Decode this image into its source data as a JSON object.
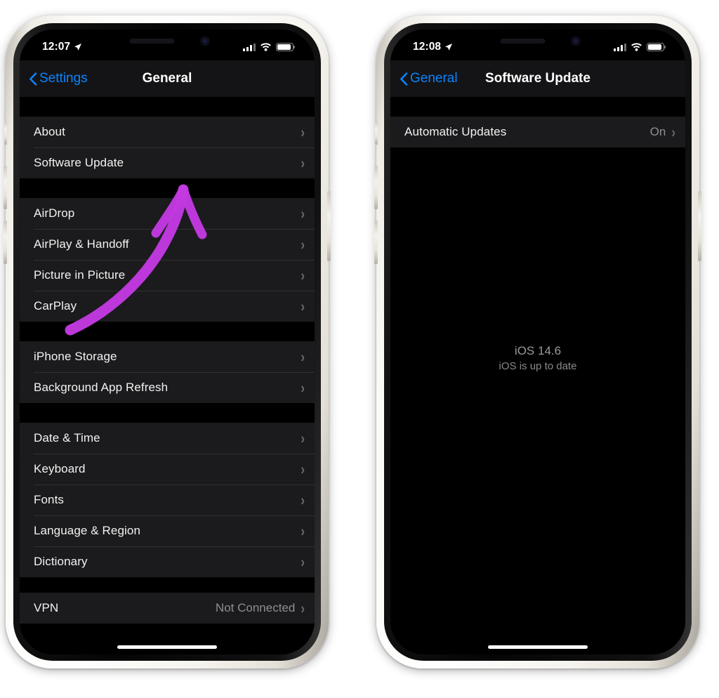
{
  "page": {
    "background_color": "#ffffff",
    "annotation_arrow_color": "#c23ae0"
  },
  "phones": [
    {
      "id": "left",
      "status_bar": {
        "time": "12:07",
        "location_icon": "location-arrow-icon",
        "signal_icon": "cellular-signal-icon",
        "wifi_icon": "wifi-icon",
        "battery_icon": "battery-icon"
      },
      "nav": {
        "back_label": "Settings",
        "back_icon": "chevron-left-icon",
        "title": "General"
      },
      "groups": [
        {
          "rows": [
            {
              "label": "About",
              "value": "",
              "accessory": "chevron-right-icon"
            },
            {
              "label": "Software Update",
              "value": "",
              "accessory": "chevron-right-icon"
            }
          ]
        },
        {
          "rows": [
            {
              "label": "AirDrop",
              "value": "",
              "accessory": "chevron-right-icon"
            },
            {
              "label": "AirPlay & Handoff",
              "value": "",
              "accessory": "chevron-right-icon"
            },
            {
              "label": "Picture in Picture",
              "value": "",
              "accessory": "chevron-right-icon"
            },
            {
              "label": "CarPlay",
              "value": "",
              "accessory": "chevron-right-icon"
            }
          ]
        },
        {
          "rows": [
            {
              "label": "iPhone Storage",
              "value": "",
              "accessory": "chevron-right-icon"
            },
            {
              "label": "Background App Refresh",
              "value": "",
              "accessory": "chevron-right-icon"
            }
          ]
        },
        {
          "rows": [
            {
              "label": "Date & Time",
              "value": "",
              "accessory": "chevron-right-icon"
            },
            {
              "label": "Keyboard",
              "value": "",
              "accessory": "chevron-right-icon"
            },
            {
              "label": "Fonts",
              "value": "",
              "accessory": "chevron-right-icon"
            },
            {
              "label": "Language & Region",
              "value": "",
              "accessory": "chevron-right-icon"
            },
            {
              "label": "Dictionary",
              "value": "",
              "accessory": "chevron-right-icon"
            }
          ]
        },
        {
          "rows": [
            {
              "label": "VPN",
              "value": "Not Connected",
              "accessory": "chevron-right-icon"
            }
          ]
        }
      ]
    },
    {
      "id": "right",
      "status_bar": {
        "time": "12:08",
        "location_icon": "location-arrow-icon",
        "signal_icon": "cellular-signal-icon",
        "wifi_icon": "wifi-icon",
        "battery_icon": "battery-icon"
      },
      "nav": {
        "back_label": "General",
        "back_icon": "chevron-left-icon",
        "title": "Software Update"
      },
      "groups": [
        {
          "rows": [
            {
              "label": "Automatic Updates",
              "value": "On",
              "accessory": "chevron-right-icon"
            }
          ]
        }
      ],
      "center_status": {
        "version": "iOS 14.6",
        "message": "iOS is up to date"
      }
    }
  ]
}
